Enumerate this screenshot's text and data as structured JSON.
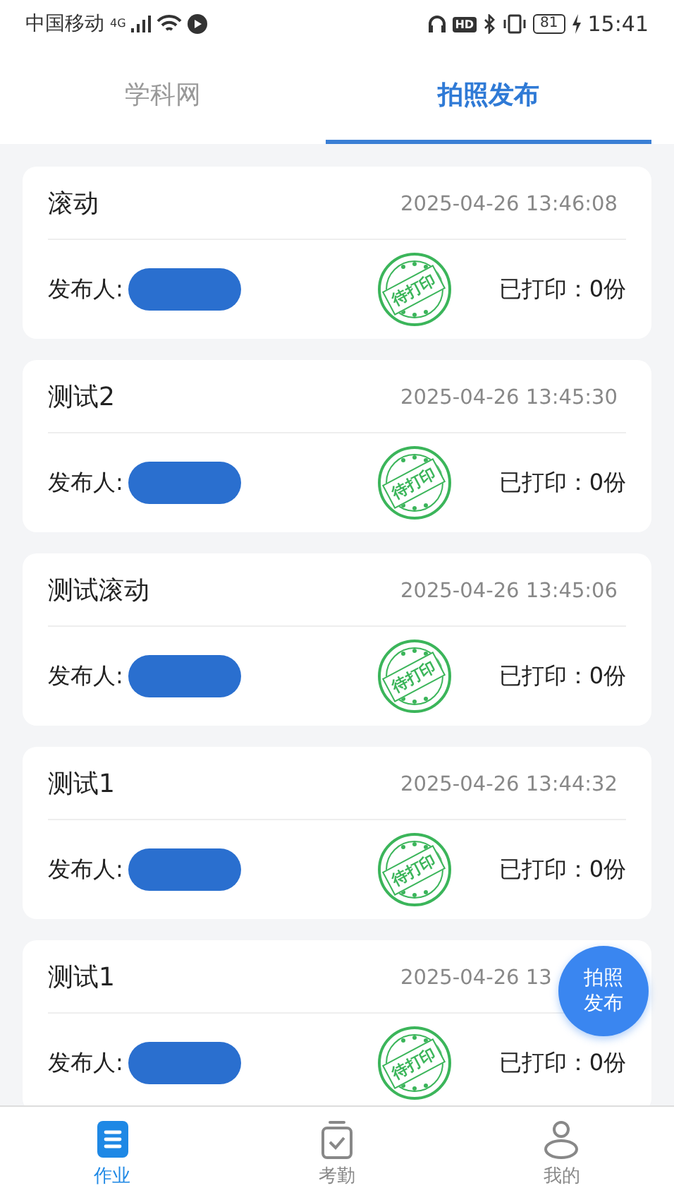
{
  "status_bar": {
    "carrier": "中国移动",
    "network": "4G",
    "hd": "HD",
    "battery": "81",
    "time": "15:41"
  },
  "tabs": [
    {
      "label": "学科网",
      "selected": false
    },
    {
      "label": "拍照发布",
      "selected": true
    }
  ],
  "posts": [
    {
      "title": "滚动",
      "time": "2025-04-26 13:46:08",
      "publisher_label": "发布人:",
      "stamp": "待打印",
      "printed": "已打印：0份"
    },
    {
      "title": "测试2",
      "time": "2025-04-26 13:45:30",
      "publisher_label": "发布人:",
      "stamp": "待打印",
      "printed": "已打印：0份"
    },
    {
      "title": "测试滚动",
      "time": "2025-04-26 13:45:06",
      "publisher_label": "发布人:",
      "stamp": "待打印",
      "printed": "已打印：0份"
    },
    {
      "title": "测试1",
      "time": "2025-04-26 13:44:32",
      "publisher_label": "发布人:",
      "stamp": "待打印",
      "printed": "已打印：0份"
    },
    {
      "title": "测试1",
      "time": "2025-04-26 13",
      "publisher_label": "发布人:",
      "stamp": "待打印",
      "printed": "已打印：0份"
    }
  ],
  "fab": {
    "label": "拍照发布"
  },
  "nav": [
    {
      "label": "作业",
      "kind": "document",
      "selected": true
    },
    {
      "label": "考勤",
      "kind": "clipboard",
      "selected": false
    },
    {
      "label": "我的",
      "kind": "person",
      "selected": false
    }
  ]
}
